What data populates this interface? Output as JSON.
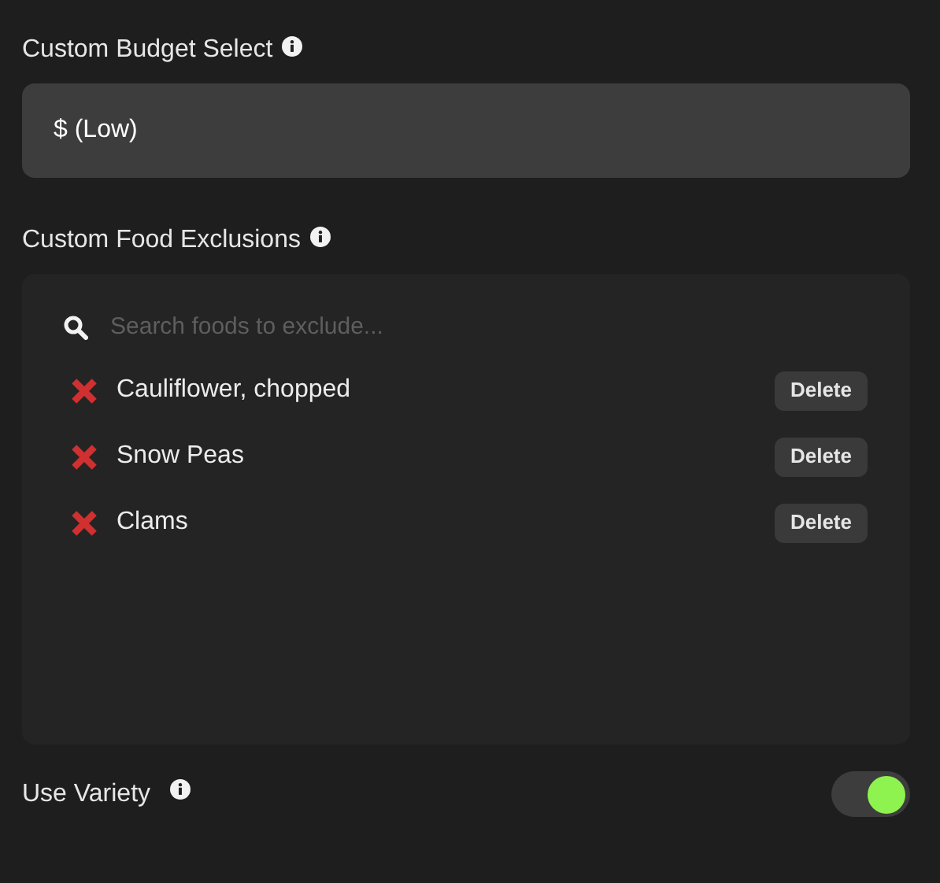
{
  "budget": {
    "label": "Custom Budget Select",
    "value": "$ (Low)"
  },
  "exclusions": {
    "label": "Custom Food Exclusions",
    "search": {
      "placeholder": "Search foods to exclude..."
    },
    "items": [
      {
        "name": "Cauliflower, chopped",
        "action": "Delete"
      },
      {
        "name": "Snow Peas",
        "action": "Delete"
      },
      {
        "name": "Clams",
        "action": "Delete"
      }
    ]
  },
  "variety": {
    "label": "Use Variety",
    "on": true
  }
}
